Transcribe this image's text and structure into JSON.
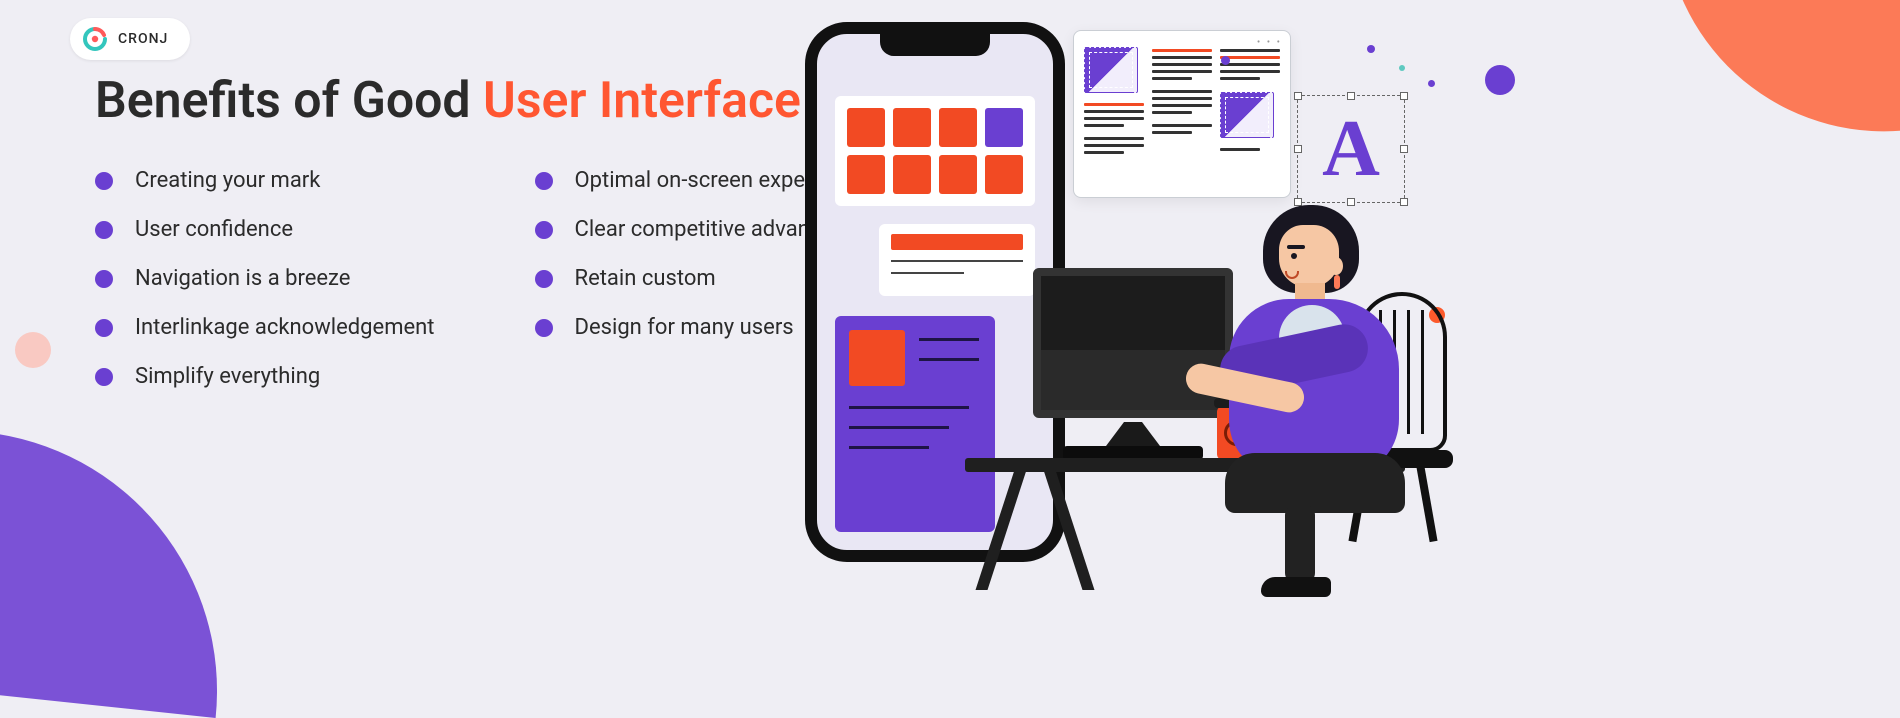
{
  "brand": {
    "name": "CRONJ"
  },
  "heading": {
    "prefix": "Benefits of Good ",
    "accent": "User Interface"
  },
  "benefits": {
    "col1": [
      "Creating your mark",
      "User confidence",
      "Navigation is a breeze",
      "Interlinkage acknowledgement",
      "Simplify everything"
    ],
    "col2": [
      "Optimal on-screen experience",
      "Clear competitive advantage",
      "Retain custom",
      "Design for many users"
    ]
  },
  "illustration": {
    "glyph": "A"
  },
  "colors": {
    "accent_orange": "#ff5631",
    "brand_purple": "#6a3fd1",
    "tile_orange": "#f24a23",
    "coral": "#fc7a57",
    "bg": "#efeef4"
  }
}
